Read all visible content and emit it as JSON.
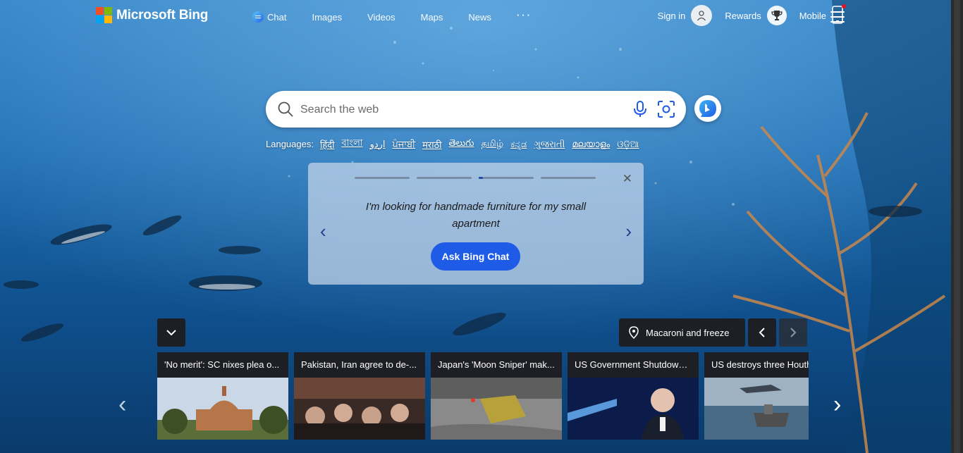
{
  "brand": {
    "name": "Microsoft Bing"
  },
  "nav": {
    "items": [
      {
        "label": "Chat"
      },
      {
        "label": "Images"
      },
      {
        "label": "Videos"
      },
      {
        "label": "Maps"
      },
      {
        "label": "News"
      }
    ],
    "more": "···"
  },
  "header": {
    "signin": "Sign in",
    "rewards": "Rewards",
    "mobile": "Mobile"
  },
  "search": {
    "placeholder": "Search the web"
  },
  "languages": {
    "label": "Languages:",
    "items": [
      "हिंदी",
      "বাংলা",
      "اردو",
      "ਪੰਜਾਬੀ",
      "मराठी",
      "తెలుగు",
      "தமிழ்",
      "ಕನ್ನಡ",
      "ગુજરાતી",
      "മലയാളം",
      "ଓଡ଼ିଆ"
    ]
  },
  "chat_card": {
    "prompt": "I'm looking for handmade furniture for my small apartment",
    "button": "Ask Bing Chat",
    "close": "✕",
    "prev": "‹",
    "next": "›",
    "steps": 4,
    "active_step": 3
  },
  "image_info": {
    "location": "Macaroni and freeze"
  },
  "news": {
    "items": [
      {
        "title": "'No merit': SC nixes plea o..."
      },
      {
        "title": "Pakistan, Iran agree to de-..."
      },
      {
        "title": "Japan's 'Moon Sniper' mak..."
      },
      {
        "title": "US Government Shutdown ..."
      },
      {
        "title": "US destroys three Houthi"
      }
    ],
    "prev": "‹",
    "next": "›"
  },
  "colors": {
    "accent": "#1e5be6",
    "card": "#c8d7eb",
    "tile": "#1d1f24"
  }
}
